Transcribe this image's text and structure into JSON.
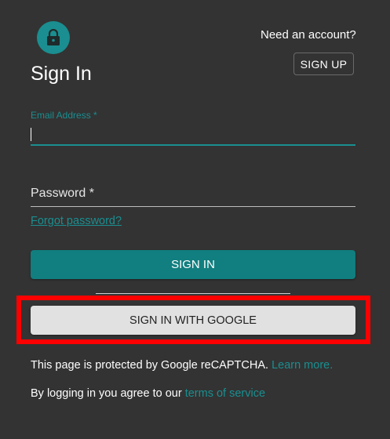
{
  "header": {
    "need_account_text": "Need an account?",
    "signup_label": "SIGN UP",
    "title": "Sign In"
  },
  "form": {
    "email_label": "Email Address *",
    "email_value": "",
    "password_label": "Password *",
    "forgot_password": "Forgot password?",
    "signin_label": "SIGN IN",
    "google_label": "SIGN IN WITH GOOGLE"
  },
  "footer": {
    "recaptcha_text": "This page is protected by Google reCAPTCHA.",
    "learn_more": "Learn more.",
    "terms_prefix": "By logging in you agree to our",
    "terms_link": "terms of service"
  },
  "icons": {
    "lock": "lock-icon"
  },
  "colors": {
    "background": "#333333",
    "accent": "#1a8e90",
    "primary_button": "#117e7f",
    "secondary_button": "#e1e1e1",
    "highlight": "#ff0000"
  }
}
